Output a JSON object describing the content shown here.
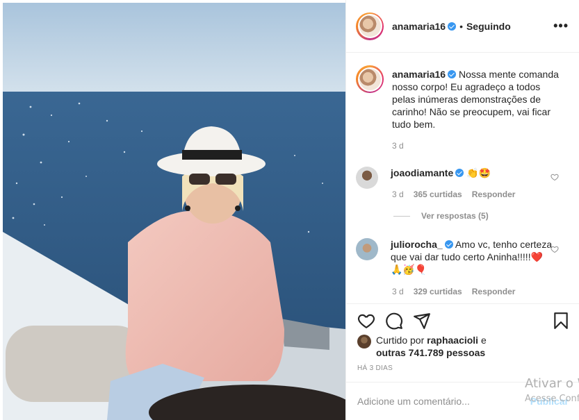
{
  "post": {
    "username": "anamaria16",
    "follow_status": "Seguindo",
    "caption": "Nossa mente comanda nosso corpo! Eu agradeço a todos pelas inúmeras demonstrações de carinho! Não se preocupem, vai ficar tudo bem.",
    "caption_time": "3 d"
  },
  "comments": [
    {
      "username": "joaodiamante",
      "text": "👏🤩",
      "time": "3 d",
      "likes": "365 curtidas",
      "reply_label": "Responder",
      "view_replies": "Ver respostas (5)"
    },
    {
      "username": "juliorocha_",
      "text": "Amo vc, tenho certeza que vai dar tudo certo Aninha!!!!!❤️🙏🥳🎈",
      "time": "3 d",
      "likes": "329 curtidas",
      "reply_label": "Responder"
    }
  ],
  "likes": {
    "prefix": "Curtido por",
    "liker": "raphaacioli",
    "connector": "e",
    "others": "outras 741.789 pessoas"
  },
  "timestamp": "HÁ 3 DIAS",
  "composer": {
    "placeholder": "Adicione um comentário...",
    "post_label": "Publicar"
  },
  "overlay": {
    "watermark_line1": "Ativar o W",
    "watermark_line2": "Acesse Conf"
  },
  "icons": {
    "verified": "verified-badge-icon",
    "more": "more-options-icon",
    "like": "heart-icon",
    "comment": "comment-icon",
    "share": "share-icon",
    "save": "bookmark-icon"
  },
  "colors": {
    "verified_blue": "#3897f0",
    "muted_text": "#8e8e8e",
    "border": "#efefef",
    "post_button": "#b2dffc"
  }
}
